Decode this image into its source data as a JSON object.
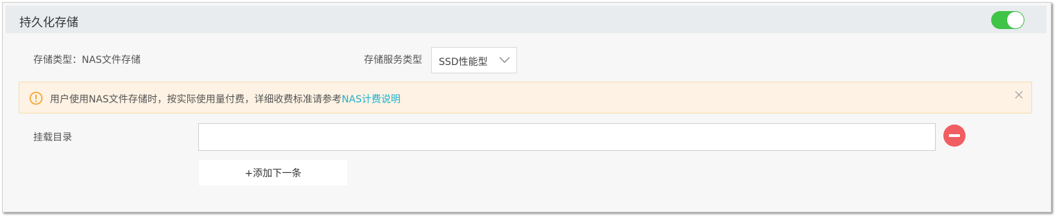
{
  "header": {
    "title": "持久化存储",
    "toggle_on": true,
    "toggle_color": "#3fc448"
  },
  "storage": {
    "type_text": "存储类型：NAS文件存储",
    "service_type_label": "存储服务类型",
    "service_type_value": "SSD性能型"
  },
  "alert": {
    "text": "用户使用NAS文件存储时，按实际使用量付费，详细收费标准请参考",
    "link": "NAS计费说明",
    "icon": "warning-circle-icon",
    "close_icon": "close-icon"
  },
  "mount": {
    "label": "挂载目录",
    "value": "",
    "remove_icon": "minus-circle-icon"
  },
  "add_button": {
    "label": "+添加下一条"
  },
  "colors": {
    "accent_link": "#1fb0cf",
    "warning": "#f0a020",
    "danger": "#f05e62"
  }
}
